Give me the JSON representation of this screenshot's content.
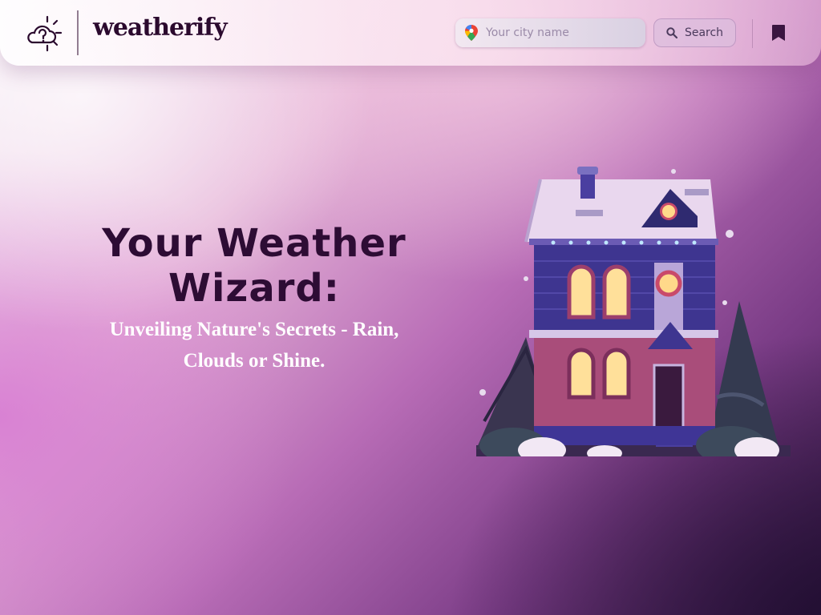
{
  "header": {
    "brand": "weatherify",
    "search": {
      "placeholder": "Your city name",
      "value": ""
    },
    "search_button_label": "Search",
    "icons": {
      "logo": "cloud-sun-question-icon",
      "location": "map-pin-icon",
      "search": "magnifier-icon",
      "bookmark": "bookmark-icon"
    }
  },
  "hero": {
    "title": "Your Weather Wizard:",
    "subtitle": "Unveiling Nature's Secrets - Rain, Clouds or Shine."
  },
  "colors": {
    "brand_text": "#2b0a2e",
    "title_text": "#2d0c34",
    "subtitle_text": "#ffffff",
    "accent_purple": "#7a3c86"
  }
}
